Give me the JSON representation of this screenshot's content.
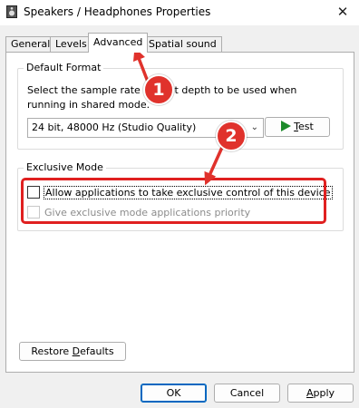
{
  "window": {
    "title": "Speakers / Headphones Properties",
    "close_symbol": "✕"
  },
  "tabs": [
    {
      "label": "General",
      "active": false
    },
    {
      "label": "Levels",
      "active": false
    },
    {
      "label": "Advanced",
      "active": true
    },
    {
      "label": "Spatial sound",
      "active": false
    }
  ],
  "default_format": {
    "group_label": "Default Format",
    "description": "Select the sample rate and bit depth to be used when running in shared mode.",
    "selected_format": "24 bit, 48000 Hz (Studio Quality)",
    "test_button": {
      "prefix": "",
      "mnemonic": "T",
      "suffix": "est"
    }
  },
  "exclusive_mode": {
    "group_label": "Exclusive Mode",
    "allow_exclusive": {
      "label": "Allow applications to take exclusive control of this device",
      "checked": false,
      "enabled": true
    },
    "priority": {
      "label": "Give exclusive mode applications priority",
      "checked": false,
      "enabled": false
    }
  },
  "buttons": {
    "restore_defaults": {
      "prefix": "Restore ",
      "mnemonic": "D",
      "suffix": "efaults"
    },
    "ok": "OK",
    "cancel": "Cancel",
    "apply": {
      "prefix": "",
      "mnemonic": "A",
      "suffix": "pply"
    }
  },
  "annotations": {
    "badge_1": "1",
    "badge_2": "2",
    "color": "#e0322c"
  }
}
